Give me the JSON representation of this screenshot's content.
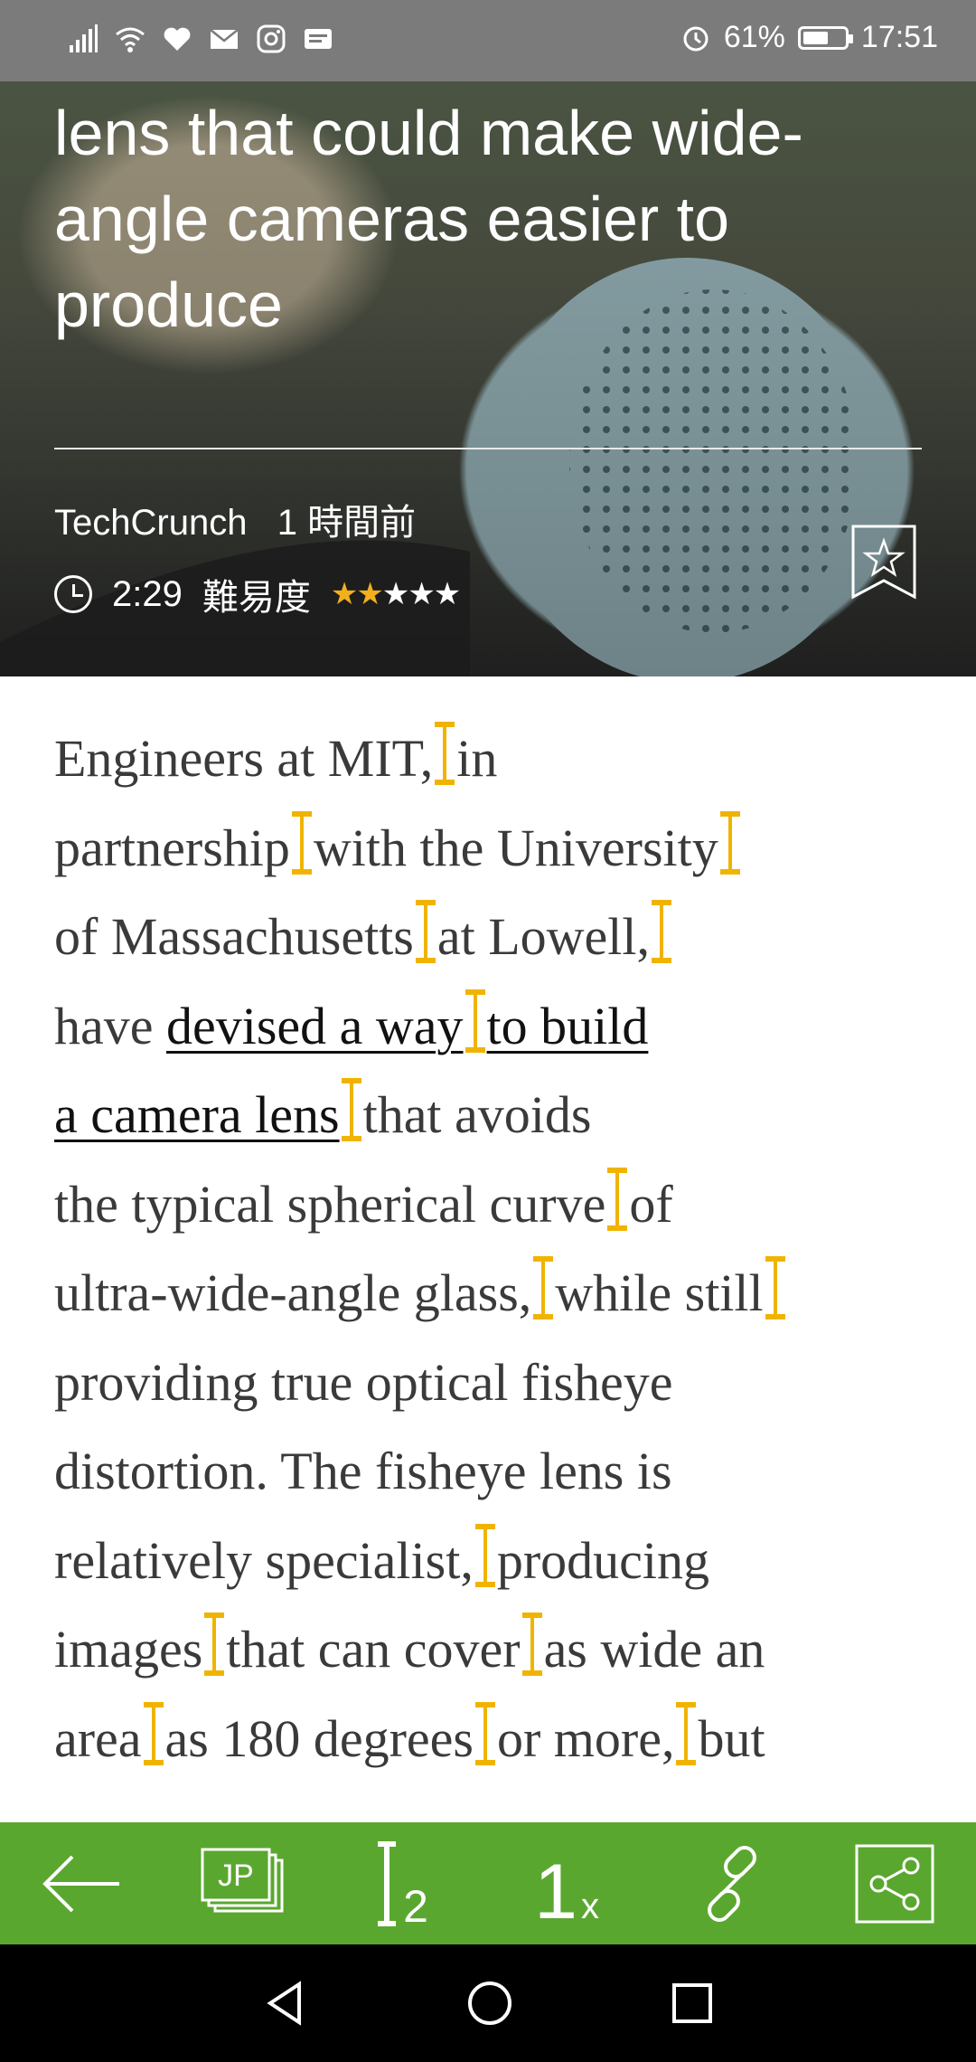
{
  "status_bar": {
    "left_icons": [
      "signal-icon",
      "wifi-icon",
      "heart-icon",
      "mail-icon",
      "instagram-icon",
      "message-icon"
    ],
    "alarm_icon": "alarm-icon",
    "battery_percent": "61%",
    "battery_level": 0.61,
    "time": "17:51"
  },
  "hero": {
    "title": "lens that could make wide-angle cameras easier to produce",
    "source": "TechCrunch",
    "time_ago": "1 時間前",
    "duration": "2:29",
    "difficulty_label": "難易度",
    "difficulty_rating": 2,
    "difficulty_max": 5,
    "bookmark_icon": "bookmark-star-icon"
  },
  "article": {
    "lines": [
      "Engineers at MIT,|in",
      "partnership|with the University|",
      "of Massachusetts|at Lowell,|",
      "have [devised a way|to build]",
      "[a camera lens]|that avoids",
      "the typical spherical curve|of",
      "ultra-wide-angle glass,|while still|",
      "providing true optical fisheye",
      "distortion. The fisheye lens is",
      "relatively specialist,|producing",
      "images|that can cover|as wide an",
      "area|as 180 degrees|or more,|but"
    ],
    "accent_color": "#f0b400"
  },
  "toolbar": {
    "back_icon": "back-arrow-icon",
    "jp_label": "JP",
    "slash_number": "2",
    "speed_number": "1",
    "speed_suffix": "x",
    "link_icon": "link-icon",
    "share_icon": "share-icon",
    "color": "#5aa72f"
  },
  "nav": {
    "back_icon": "nav-back-icon",
    "home_icon": "nav-home-icon",
    "recent_icon": "nav-recent-icon"
  }
}
